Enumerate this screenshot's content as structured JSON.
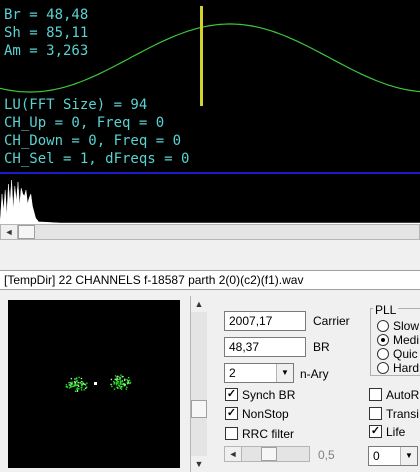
{
  "scope": {
    "lines": [
      "Br = 48,48",
      "Sh = 85,11",
      "Am = 3,263",
      "LU(FFT Size) = 94",
      "CH_Up = 0, Freq = 0",
      "CH_Down = 0, Freq = 0",
      "CH_Sel = 1, dFreqs = 0"
    ],
    "wave_color": "#3cc83c",
    "marker_color": "#d2d22a"
  },
  "scroll_arrows": {
    "left": "◄",
    "up": "▲",
    "down": "▼"
  },
  "file_path": "[TempDir] 22 CHANNELS f-18587 parth 2(0)(c2)(f1).wav",
  "controls": {
    "carrier": {
      "value": "2007,17",
      "label": "Carrier"
    },
    "br": {
      "value": "48,37",
      "label": "BR"
    },
    "nary": {
      "value": "2",
      "label": "n-Ary"
    },
    "synch_br": {
      "label": "Synch BR",
      "checked": true
    },
    "nonstop": {
      "label": "NonStop",
      "checked": true
    },
    "rrc_filter": {
      "label": "RRC filter",
      "checked": false
    },
    "slider_value": "0,5",
    "check_mark": "✓"
  },
  "pll": {
    "title": "PLL",
    "options": [
      "Slow",
      "Medi",
      "Quic",
      "Hard"
    ],
    "selected": 1
  },
  "right": {
    "autor": {
      "label": "AutoR",
      "checked": false
    },
    "transi": {
      "label": "Transi",
      "checked": false
    },
    "life": {
      "label": "Life",
      "checked": true
    },
    "select_value": "0"
  }
}
